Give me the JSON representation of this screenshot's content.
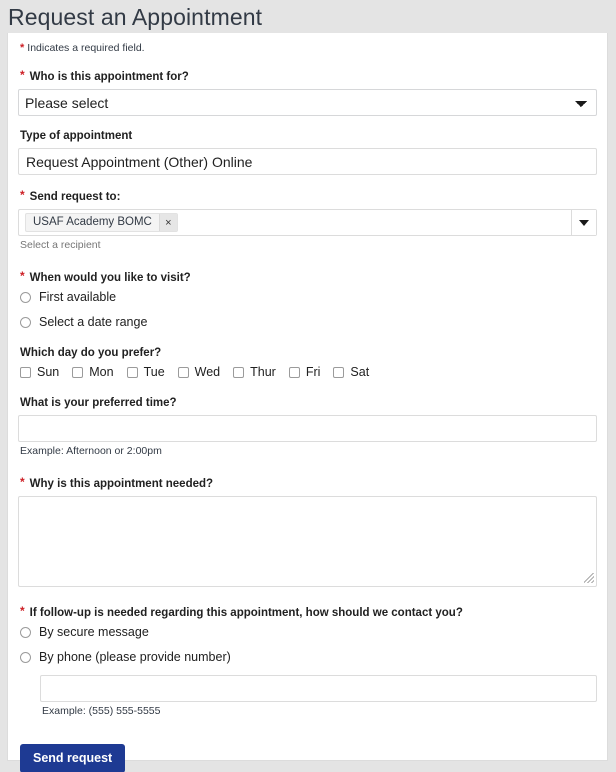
{
  "page": {
    "title": "Request an Appointment",
    "required_note": "Indicates a required field.",
    "required_marker": "*"
  },
  "form": {
    "who": {
      "label": "Who is this appointment for?",
      "required": true,
      "selected": "Please select",
      "options": [
        "Please select"
      ]
    },
    "type_of_appointment": {
      "label": "Type of appointment",
      "required": false,
      "value": "Request Appointment (Other) Online"
    },
    "send_request_to": {
      "label": "Send request to:",
      "required": true,
      "chips": [
        {
          "label": "USAF Academy BOMC",
          "remove_icon": "×"
        }
      ],
      "helper": "Select a recipient",
      "toggle_icon": "caret-down-icon"
    },
    "when_visit": {
      "label": "When would you like to visit?",
      "required": true,
      "options": [
        {
          "label": "First available",
          "selected": false
        },
        {
          "label": "Select a date range",
          "selected": false
        }
      ]
    },
    "preferred_day": {
      "label": "Which day do you prefer?",
      "required": false,
      "options": [
        {
          "label": "Sun",
          "checked": false
        },
        {
          "label": "Mon",
          "checked": false
        },
        {
          "label": "Tue",
          "checked": false
        },
        {
          "label": "Wed",
          "checked": false
        },
        {
          "label": "Thur",
          "checked": false
        },
        {
          "label": "Fri",
          "checked": false
        },
        {
          "label": "Sat",
          "checked": false
        }
      ]
    },
    "preferred_time": {
      "label": "What is your preferred time?",
      "required": false,
      "value": "",
      "placeholder": "",
      "helper": "Example: Afternoon or 2:00pm"
    },
    "reason": {
      "label": "Why is this appointment needed?",
      "required": true,
      "value": "",
      "placeholder": ""
    },
    "follow_up": {
      "label": "If follow-up is needed regarding this appointment, how should we contact you?",
      "required": true,
      "options": [
        {
          "label": "By secure message",
          "selected": false
        },
        {
          "label": "By phone (please provide number)",
          "selected": false
        }
      ],
      "phone": {
        "value": "",
        "placeholder": "",
        "helper": "Example: (555) 555-5555"
      }
    },
    "submit": {
      "label": "Send request"
    }
  },
  "colors": {
    "required_asterisk": "#cd2026",
    "submit_background": "#1e3a93",
    "page_background": "#e4e4e4",
    "panel_background": "#ffffff",
    "border": "#dcdcdc"
  }
}
